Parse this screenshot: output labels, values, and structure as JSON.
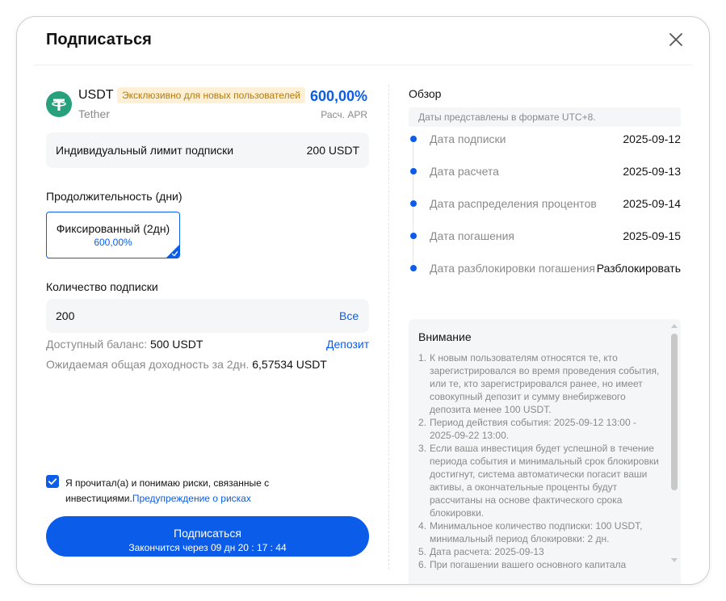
{
  "modal": {
    "title": "Подписаться"
  },
  "product": {
    "coin": "USDT",
    "coin_full": "Tether",
    "badge": "Эксклюзивно для новых пользователей",
    "apr_value": "600,00%",
    "apr_label": "Расч. APR"
  },
  "limit": {
    "label": "Индивидуальный лимит подписки",
    "value": "200 USDT"
  },
  "duration": {
    "label": "Продолжительность (дни)",
    "option_label": "Фиксированный (2дн)",
    "option_apr": "600,00%"
  },
  "quantity": {
    "label": "Количество подписки",
    "value": "200",
    "all_label": "Все"
  },
  "balance": {
    "label": "Доступный баланс:",
    "value": "500 USDT",
    "deposit_label": "Депозит"
  },
  "yield": {
    "label": "Ожидаемая общая доходность за 2дн.",
    "value": "6,57534 USDT"
  },
  "agreement": {
    "checked": true,
    "text": "Я прочитал(а) и понимаю риски, связанные с инвестициями.",
    "link": "Предупреждение о рисках"
  },
  "subscribe": {
    "label": "Подписаться",
    "countdown": "Закончится через 09 дн 20 : 17 : 44"
  },
  "overview": {
    "title": "Обзор",
    "tz_note": "Даты представлены в формате UTC+8.",
    "items": [
      {
        "label": "Дата подписки",
        "value": "2025-09-12"
      },
      {
        "label": "Дата расчета",
        "value": "2025-09-13"
      },
      {
        "label": "Дата распределения процентов",
        "value": "2025-09-14"
      },
      {
        "label": "Дата погашения",
        "value": "2025-09-15"
      },
      {
        "label": "Дата разблокировки погашения",
        "value": "Разблокировать"
      }
    ]
  },
  "notice": {
    "title": "Внимание",
    "items": [
      {
        "num": "1.",
        "text": "К новым пользователям относятся те, кто зарегистрировался во время проведения события, или те, кто зарегистрировался ранее, но имеет совокупный депозит и сумму внебиржевого депозита менее 100 USDT."
      },
      {
        "num": "2.",
        "text": "Период действия события: 2025-09-12 13:00 - 2025-09-22 13:00."
      },
      {
        "num": "3.",
        "text": "Если ваша инвестиция будет успешной в течение периода события и минимальный срок блокировки достигнут, система автоматически погасит ваши активы, а окончательные проценты будут рассчитаны на основе фактического срока блокировки."
      },
      {
        "num": "4.",
        "text": "Минимальное количество подписки: 100 USDT, минимальный период блокировки: 2 дн."
      },
      {
        "num": "5.",
        "text": "Дата расчета: 2025-09-13"
      },
      {
        "num": "6.",
        "text": "При погашении вашего основного капитала"
      }
    ]
  },
  "colors": {
    "accent": "#0b5ce8",
    "tether": "#26a17b",
    "badge_bg": "#fdf0d4",
    "badge_text": "#b27a14"
  },
  "icons": {
    "close": "close-icon",
    "coin": "tether-icon",
    "check": "check-icon"
  }
}
